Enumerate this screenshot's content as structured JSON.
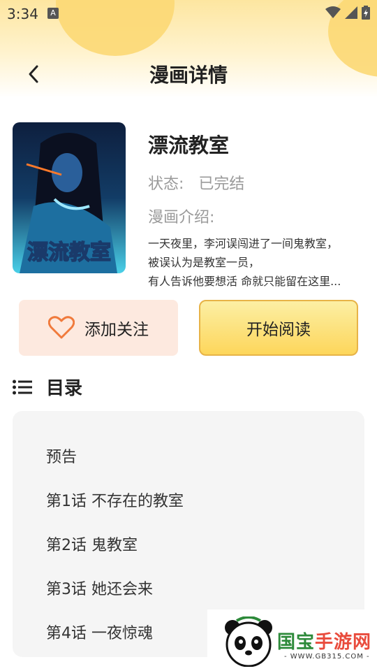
{
  "status_bar": {
    "time": "3:34",
    "badge": "A"
  },
  "nav": {
    "title": "漫画详情"
  },
  "comic": {
    "title": "漂流教室",
    "cover_text": "漂流教室",
    "status_label": "状态:",
    "status_value": "已完结",
    "intro_label": "漫画介绍:",
    "intro_lines": [
      "一天夜里，李河误闯进了一间鬼教室，",
      "被误认为是教室一员，",
      "有人告诉他要想活 命就只能留在这里..."
    ]
  },
  "buttons": {
    "follow": "添加关注",
    "read": "开始阅读"
  },
  "toc": {
    "title": "目录",
    "items": [
      "预告",
      "第1话 不存在的教室",
      "第2话 鬼教室",
      "第3话 她还会来",
      "第4话 一夜惊魂"
    ]
  },
  "watermark": {
    "name_part1": "国宝",
    "name_part2": "手游网",
    "url": "- WWW.GB315.COM -"
  },
  "colors": {
    "accent_yellow": "#fdd65b",
    "follow_bg": "#fde9df",
    "heart": "#f07a3c"
  }
}
